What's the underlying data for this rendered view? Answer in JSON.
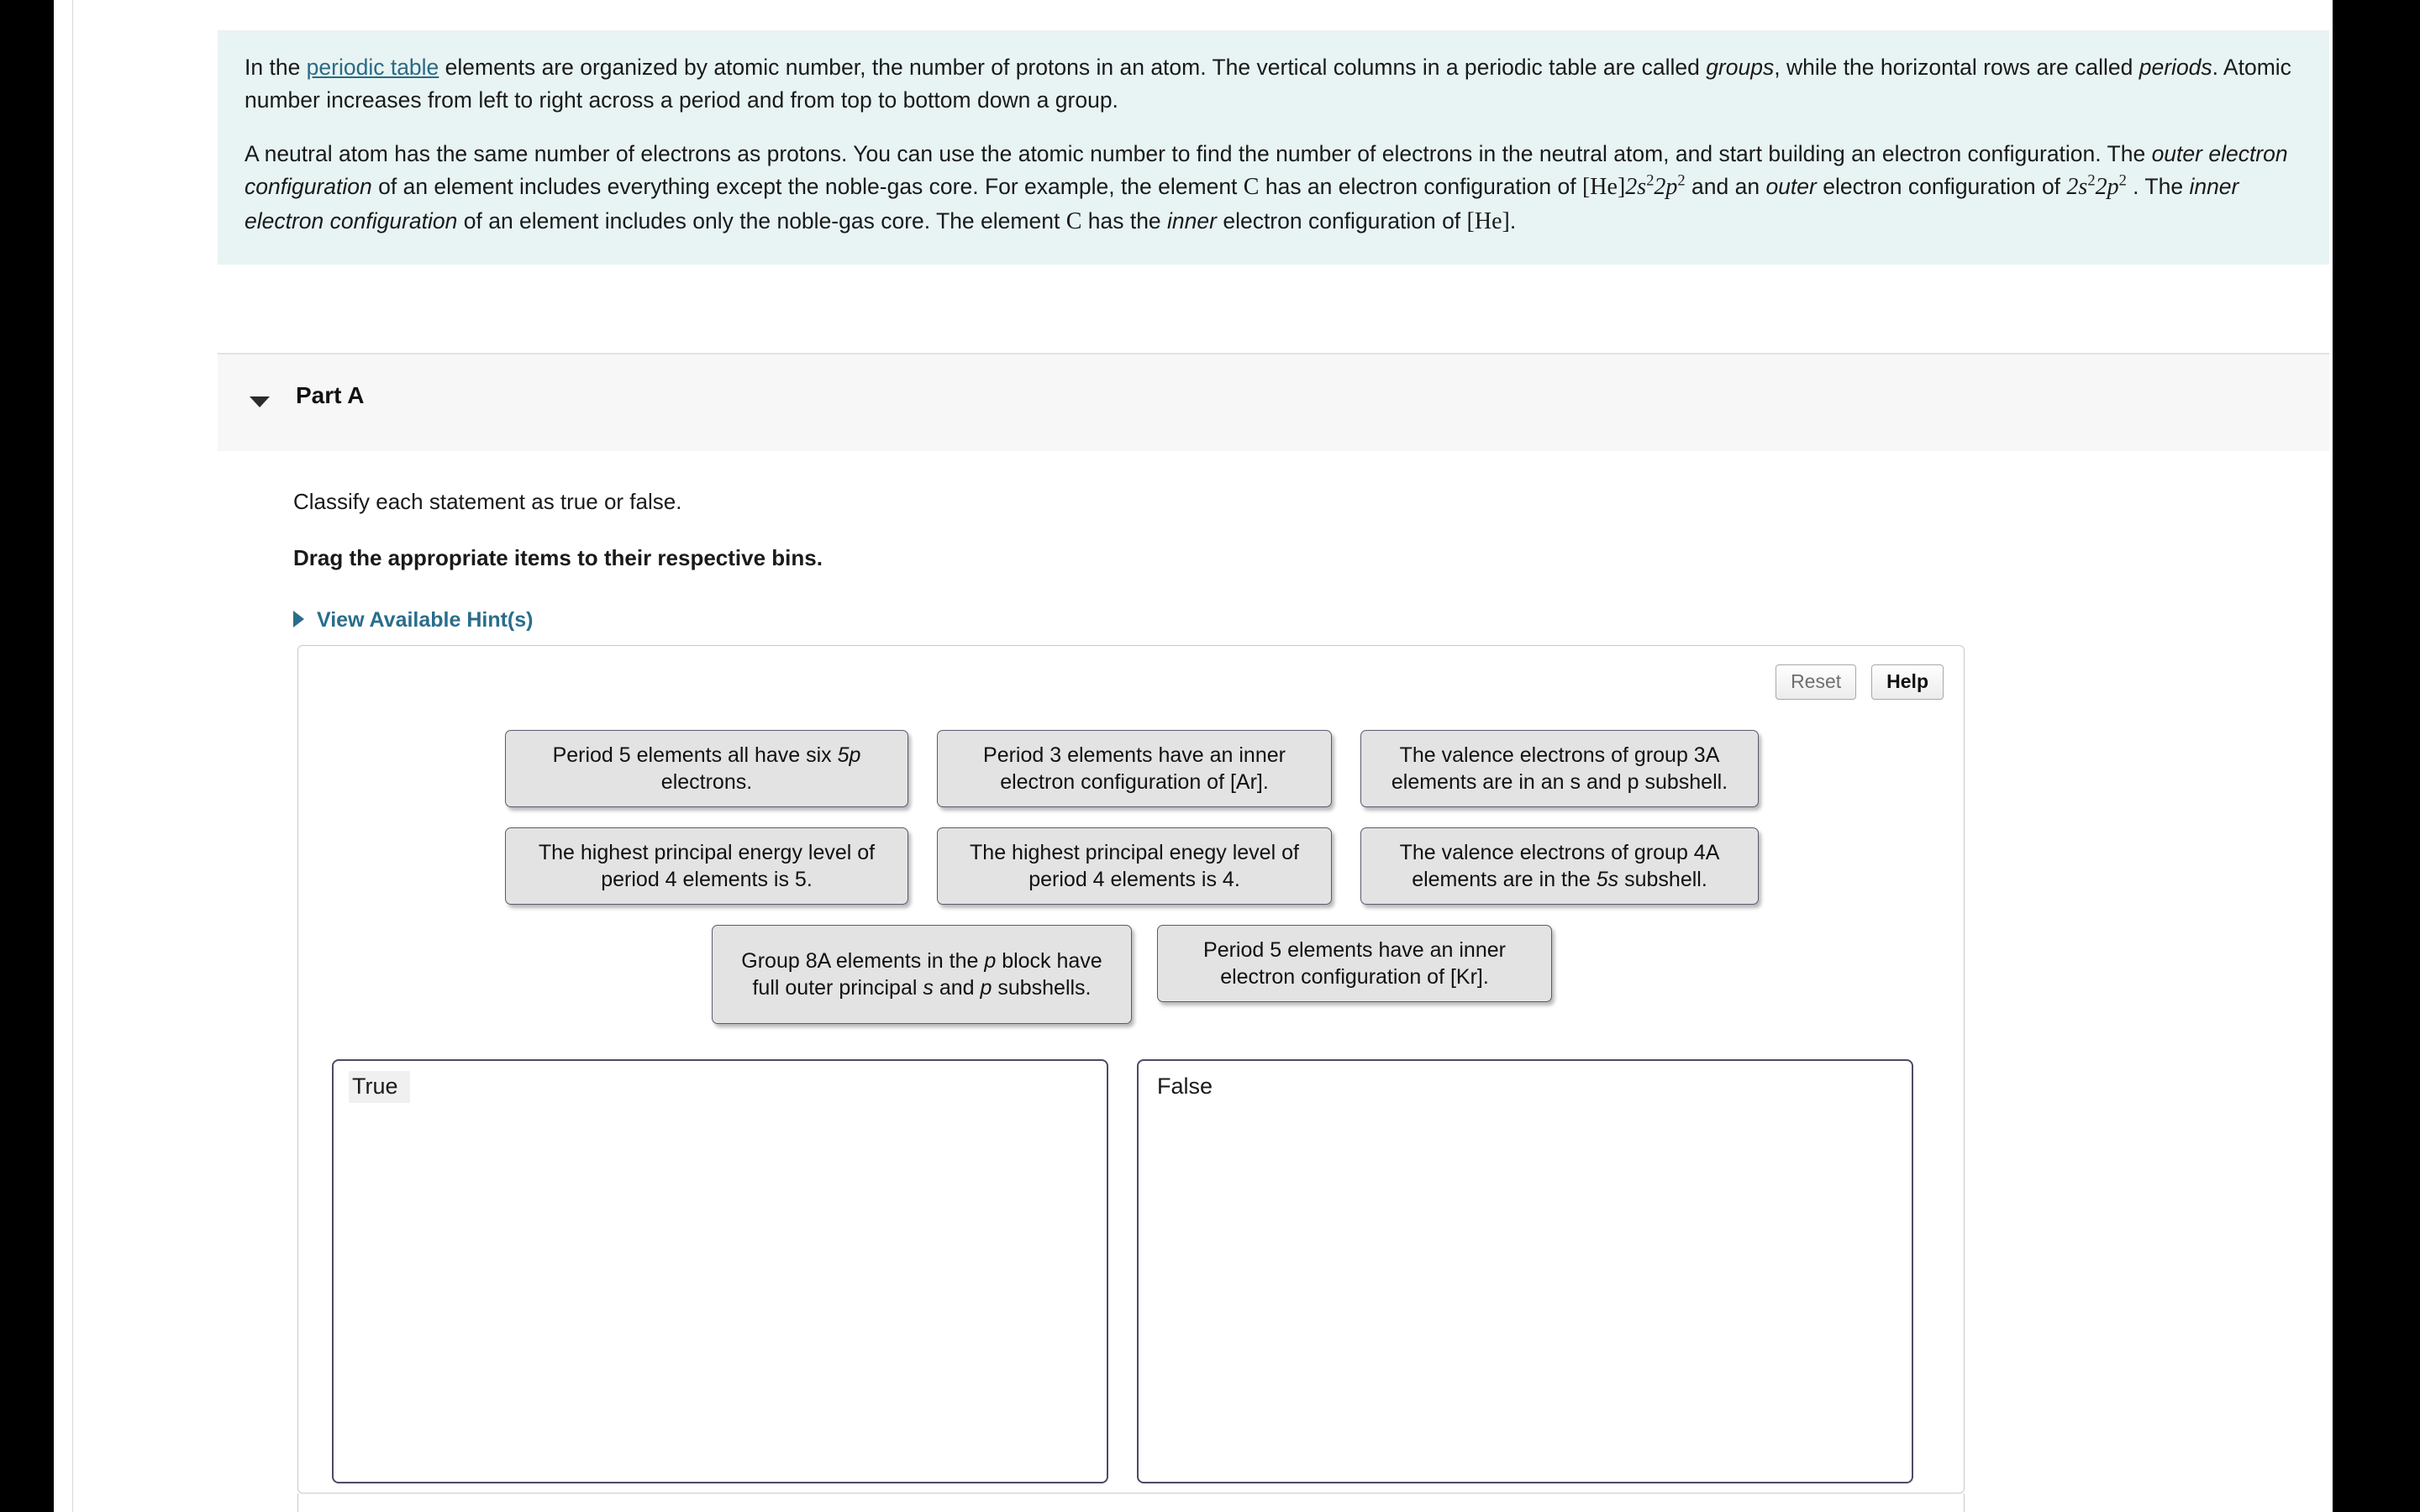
{
  "intro": {
    "p1_a": "In the ",
    "p1_link": "periodic table",
    "p1_b": " elements are organized by atomic number, the number of protons in an atom. The vertical columns in a periodic table are called ",
    "p1_groups": "groups",
    "p1_c": ", while the horizontal rows are called ",
    "p1_periods": "periods",
    "p1_d": ". Atomic number increases from left to right across a period and from top to bottom down a group.",
    "p2_a": "A neutral atom has the same number of electrons as protons. You can use the atomic number to find the number of electrons in the neutral atom, and start building an electron configuration. The ",
    "p2_outer_em": "outer electron configuration",
    "p2_b": " of an element includes everything except the noble-gas core. For example, the element ",
    "p2_C1": "C",
    "p2_c": " has an electron configuration of ",
    "p2_math1": "[He]2s²2p²",
    "p2_d": " and an ",
    "p2_outer": "outer",
    "p2_e": " electron configuration of ",
    "p2_math2": "2s²2p²",
    "p2_f": " . The ",
    "p2_inner_em": "inner electron configuration",
    "p2_g": " of an element includes only the noble-gas core. The element ",
    "p2_C2": "C",
    "p2_h": " has the ",
    "p2_inner": "inner",
    "p2_i": " electron configuration of ",
    "p2_math3": "[He]",
    "p2_j": "."
  },
  "part": {
    "title": "Part A",
    "caret_icon": "caret-down-icon"
  },
  "question": {
    "classify": "Classify each statement as true or false.",
    "drag": "Drag the appropriate items to their respective bins.",
    "hint_label": "View Available Hint(s)",
    "hint_icon": "triangle-right-icon"
  },
  "answer_area": {
    "reset_label": "Reset",
    "help_label": "Help",
    "tiles": [
      {
        "id": "tile-1",
        "text": "Period 5 elements all have six 5p electrons.",
        "em": "5p"
      },
      {
        "id": "tile-2",
        "text": "Period 3 elements have an inner electron configuration of [Ar]."
      },
      {
        "id": "tile-3",
        "text": "The valence electrons of group 3A elements are in an s and p subshell."
      },
      {
        "id": "tile-4",
        "text": "The highest principal energy level of period 4 elements is 5."
      },
      {
        "id": "tile-5",
        "text": "The highest principal enegy level of period 4 elements is 4."
      },
      {
        "id": "tile-6",
        "text": "The valence electrons of group 4A elements are in the 5s subshell.",
        "em": "5s"
      },
      {
        "id": "tile-7",
        "text": "Group 8A elements in the p block have full outer principal s and p subshells."
      },
      {
        "id": "tile-8",
        "text": "Period 5 elements have an inner electron configuration of [Kr]."
      }
    ],
    "bins": [
      {
        "id": "bin-true",
        "label": "True",
        "items": []
      },
      {
        "id": "bin-false",
        "label": "False",
        "items": []
      }
    ]
  },
  "colors": {
    "intro_bg": "#e8f4f3",
    "link": "#2b6a85",
    "hint": "#2a6d8c",
    "tile_bg": "#e3e3e3",
    "bin_border": "#4b4b66"
  }
}
